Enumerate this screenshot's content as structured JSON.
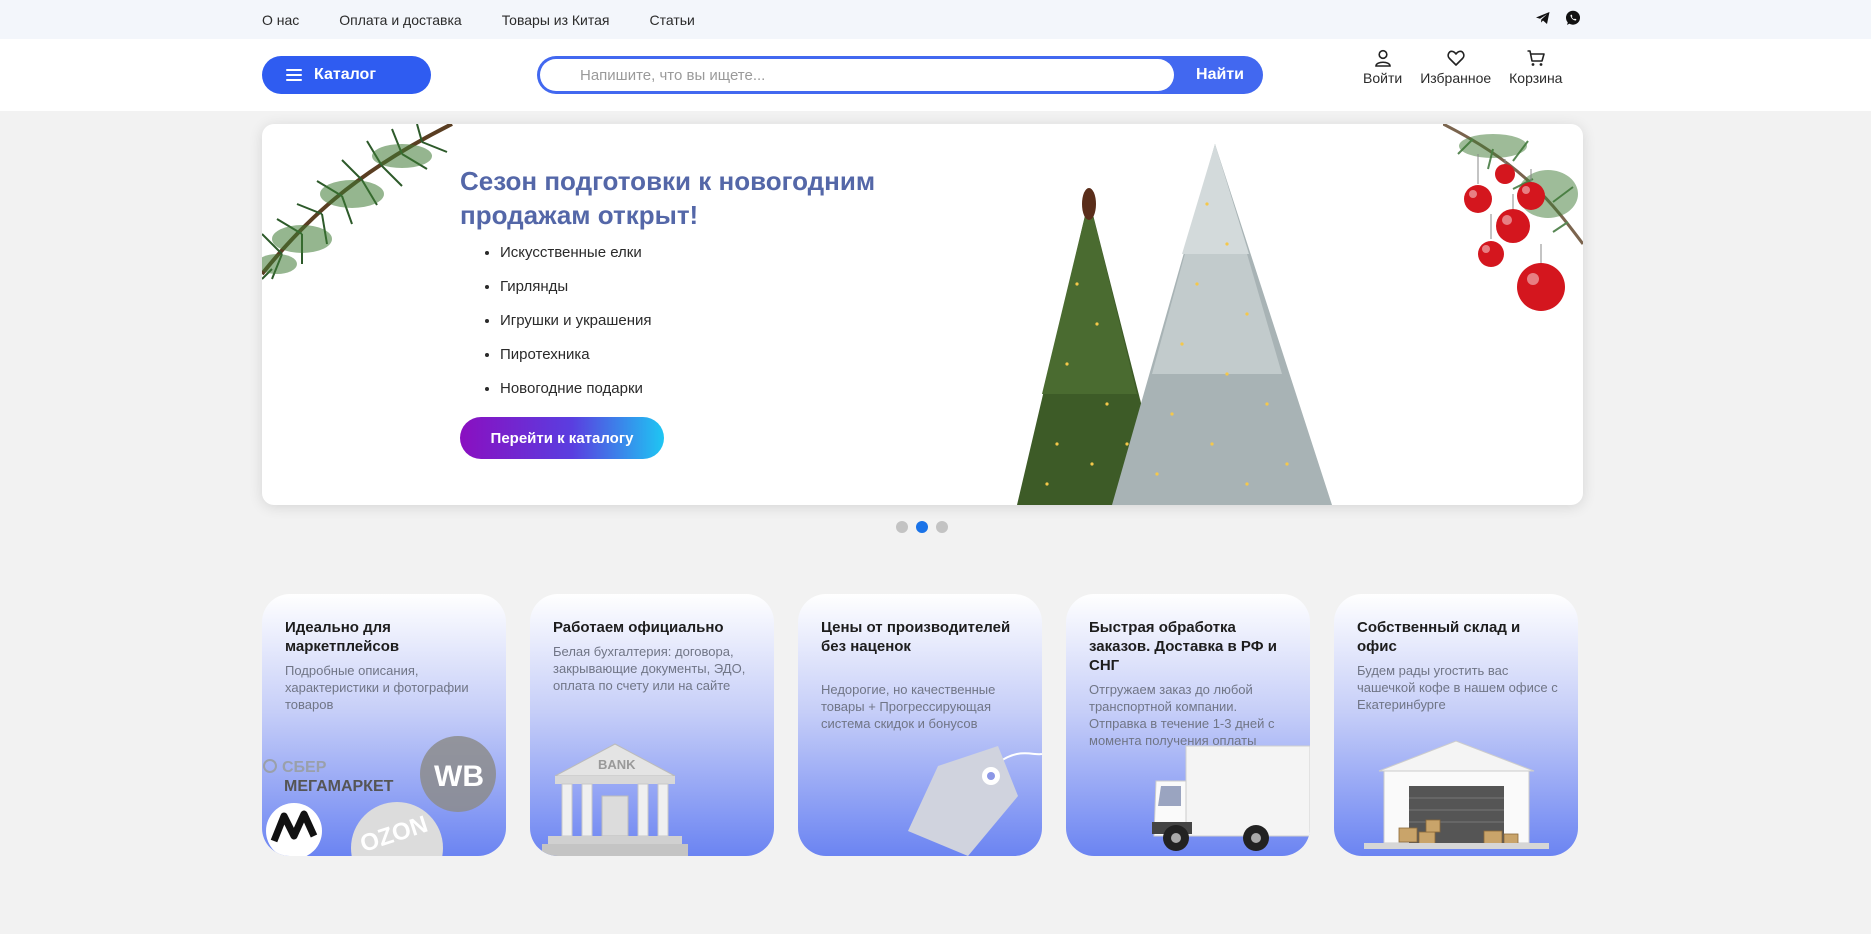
{
  "topnav": {
    "links": [
      "О нас",
      "Оплата и доставка",
      "Товары из Китая",
      "Статьи"
    ],
    "social_icons": [
      "telegram-icon",
      "whatsapp-icon"
    ]
  },
  "header": {
    "catalog_label": "Каталог",
    "search_placeholder": "Напишите, что вы ищете...",
    "search_button": "Найти",
    "login_label": "Войти",
    "favorites_label": "Избранное",
    "cart_label": "Корзина"
  },
  "banner": {
    "title": "Сезон подготовки к новогодним продажам открыт!",
    "items": [
      "Искусственные елки",
      "Гирлянды",
      "Игрушки и украшения",
      "Пиротехника",
      "Новогодние подарки"
    ],
    "cta_label": "Перейти к каталогу",
    "slide_count": 3,
    "active_slide": 2
  },
  "cards": [
    {
      "title": "Идеально для маркетплейсов",
      "text": "Подробные описания, характеристики и фотографии товаров",
      "logo_texts": [
        "СБЕР",
        "МЕГАМАРКЕТ",
        "WB",
        "OZON"
      ]
    },
    {
      "title": "Работаем официально",
      "text": "Белая бухгалтерия: договора, закрывающие документы, ЭДО, оплата по счету или на сайте",
      "bank_text": "BANK"
    },
    {
      "title": "Цены от производителей без наценок",
      "text": "Недорогие, но качественные товары + Прогрессирующая система скидок и бонусов"
    },
    {
      "title": "Быстрая обработка заказов. Доставка в РФ и СНГ",
      "text": "Отгружаем заказ до любой транспортной компании. Отправка в течение 1-3 дней с момента получения оплаты"
    },
    {
      "title": "Собственный склад и офис",
      "text": "Будем рады угостить вас чашечкой кофе в нашем офисе с Екатеринбурге"
    }
  ],
  "colors": {
    "accent": "#2f5cf1",
    "banner_title": "#5467a8",
    "dot_active": "#1a73e8"
  }
}
